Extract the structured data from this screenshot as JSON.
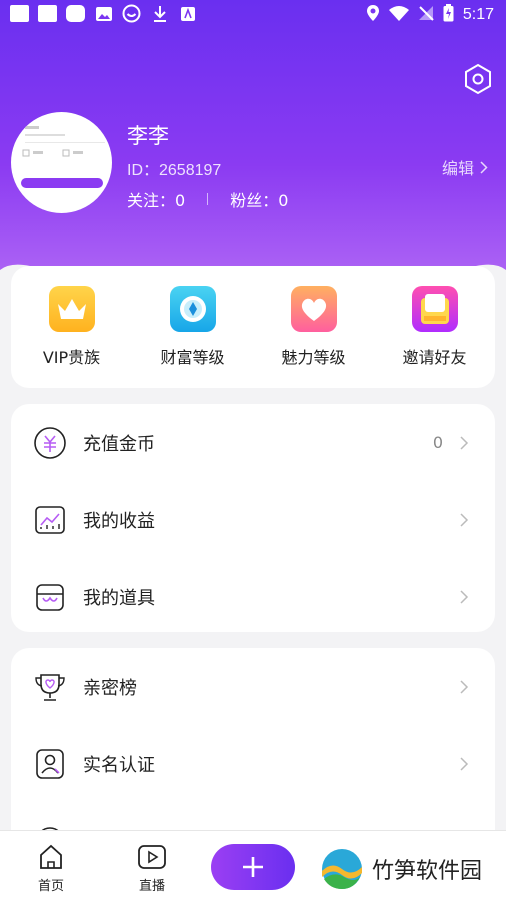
{
  "status_bar": {
    "time": "5:17"
  },
  "profile": {
    "name": "李李",
    "id_text": "ID：2658197",
    "edit_label": "编辑",
    "follow_text": "关注：0",
    "fans_text": "粉丝：0"
  },
  "quick_items": [
    {
      "label": "VIP贵族",
      "icon": "crown-icon"
    },
    {
      "label": "财富等级",
      "icon": "wealth-icon"
    },
    {
      "label": "魅力等级",
      "icon": "heart-icon"
    },
    {
      "label": "邀请好友",
      "icon": "invite-icon"
    }
  ],
  "menu1": [
    {
      "label": "充值金币",
      "value": "0",
      "icon": "coin-icon"
    },
    {
      "label": "我的收益",
      "icon": "earnings-icon"
    },
    {
      "label": "我的道具",
      "icon": "props-icon"
    }
  ],
  "menu2": [
    {
      "label": "亲密榜",
      "icon": "trophy-icon"
    },
    {
      "label": "实名认证",
      "icon": "verify-icon"
    }
  ],
  "bottom_nav": {
    "home_label": "首页",
    "live_label": "直播"
  },
  "watermark": {
    "text": "竹笋软件园"
  },
  "colors": {
    "accent": "#7b35f1",
    "header_top": "#6a2ff0",
    "header_bottom": "#b46cf5"
  }
}
